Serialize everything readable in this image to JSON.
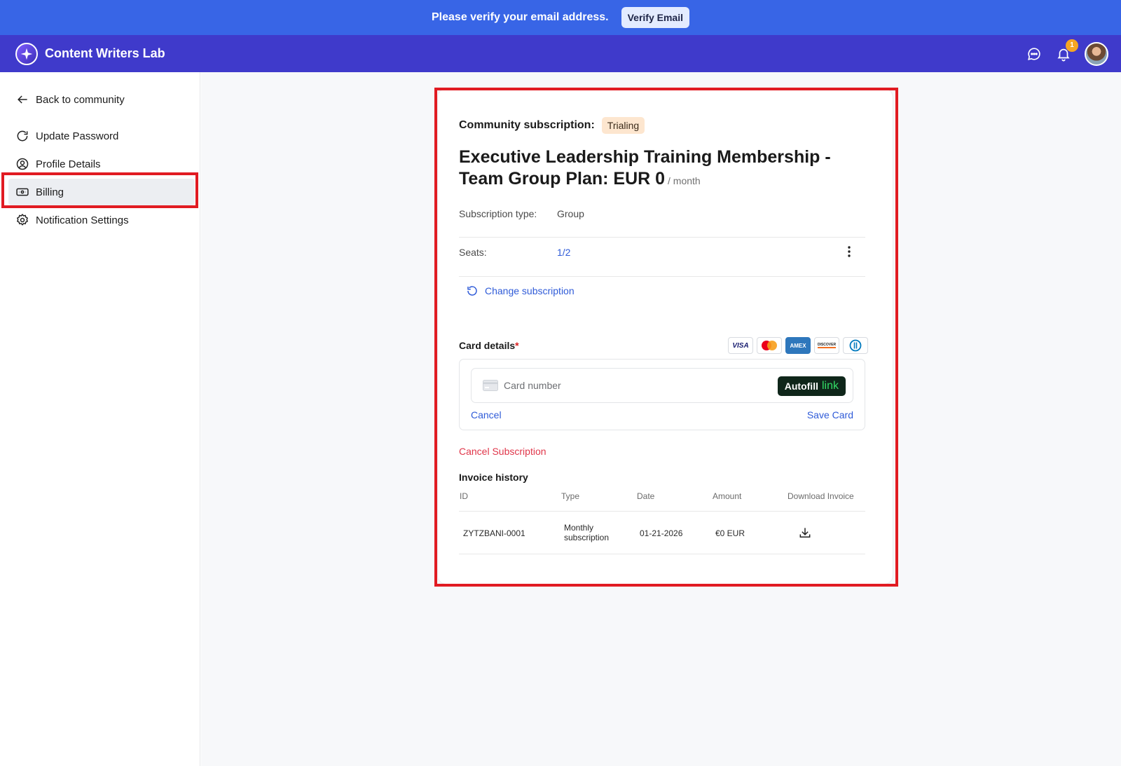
{
  "verify_banner": {
    "text": "Please verify your email address.",
    "button_label": "Verify Email"
  },
  "header": {
    "brand": "Content Writers Lab",
    "notification_count": "1",
    "icons": [
      "chat-icon",
      "bell-icon"
    ]
  },
  "sidebar": {
    "items": [
      {
        "label": "Back to community",
        "icon": "arrow-left-icon",
        "active": false
      },
      {
        "label": "Update Password",
        "icon": "refresh-icon",
        "active": false
      },
      {
        "label": "Profile Details",
        "icon": "user-circle-icon",
        "active": false
      },
      {
        "label": "Billing",
        "icon": "billing-icon",
        "active": true
      },
      {
        "label": "Notification Settings",
        "icon": "gear-icon",
        "active": false
      }
    ]
  },
  "subscription": {
    "label": "Community subscription:",
    "status": "Trialing",
    "plan_title": "Executive Leadership Training Membership - Team Group Plan: EUR 0",
    "period": "/ month",
    "type_label": "Subscription type:",
    "type_value": "Group",
    "seats_label": "Seats:",
    "seats_value": "1/2",
    "change_label": "Change subscription"
  },
  "card_details": {
    "label": "Card details",
    "required_mark": "*",
    "brands": [
      "VISA",
      "AMEX",
      "DISCOVER"
    ],
    "placeholder": "Card number",
    "autofill_label": "Autofill",
    "autofill_link": "link",
    "cancel_label": "Cancel",
    "save_label": "Save Card"
  },
  "cancel_subscription_label": "Cancel Subscription",
  "invoice_history": {
    "title": "Invoice history",
    "columns": [
      "ID",
      "Type",
      "Date",
      "Amount",
      "Download Invoice"
    ],
    "rows": [
      {
        "id": "ZYTZBANI-0001",
        "type_line1": "Monthly",
        "type_line2": "subscription",
        "date": "01-21-2026",
        "amount": "€0 EUR"
      }
    ]
  },
  "colors": {
    "banner": "#3865e6",
    "header": "#3f3acb",
    "link": "#2f5bd8",
    "danger": "#e0364a",
    "highlight": "#e11b22"
  }
}
